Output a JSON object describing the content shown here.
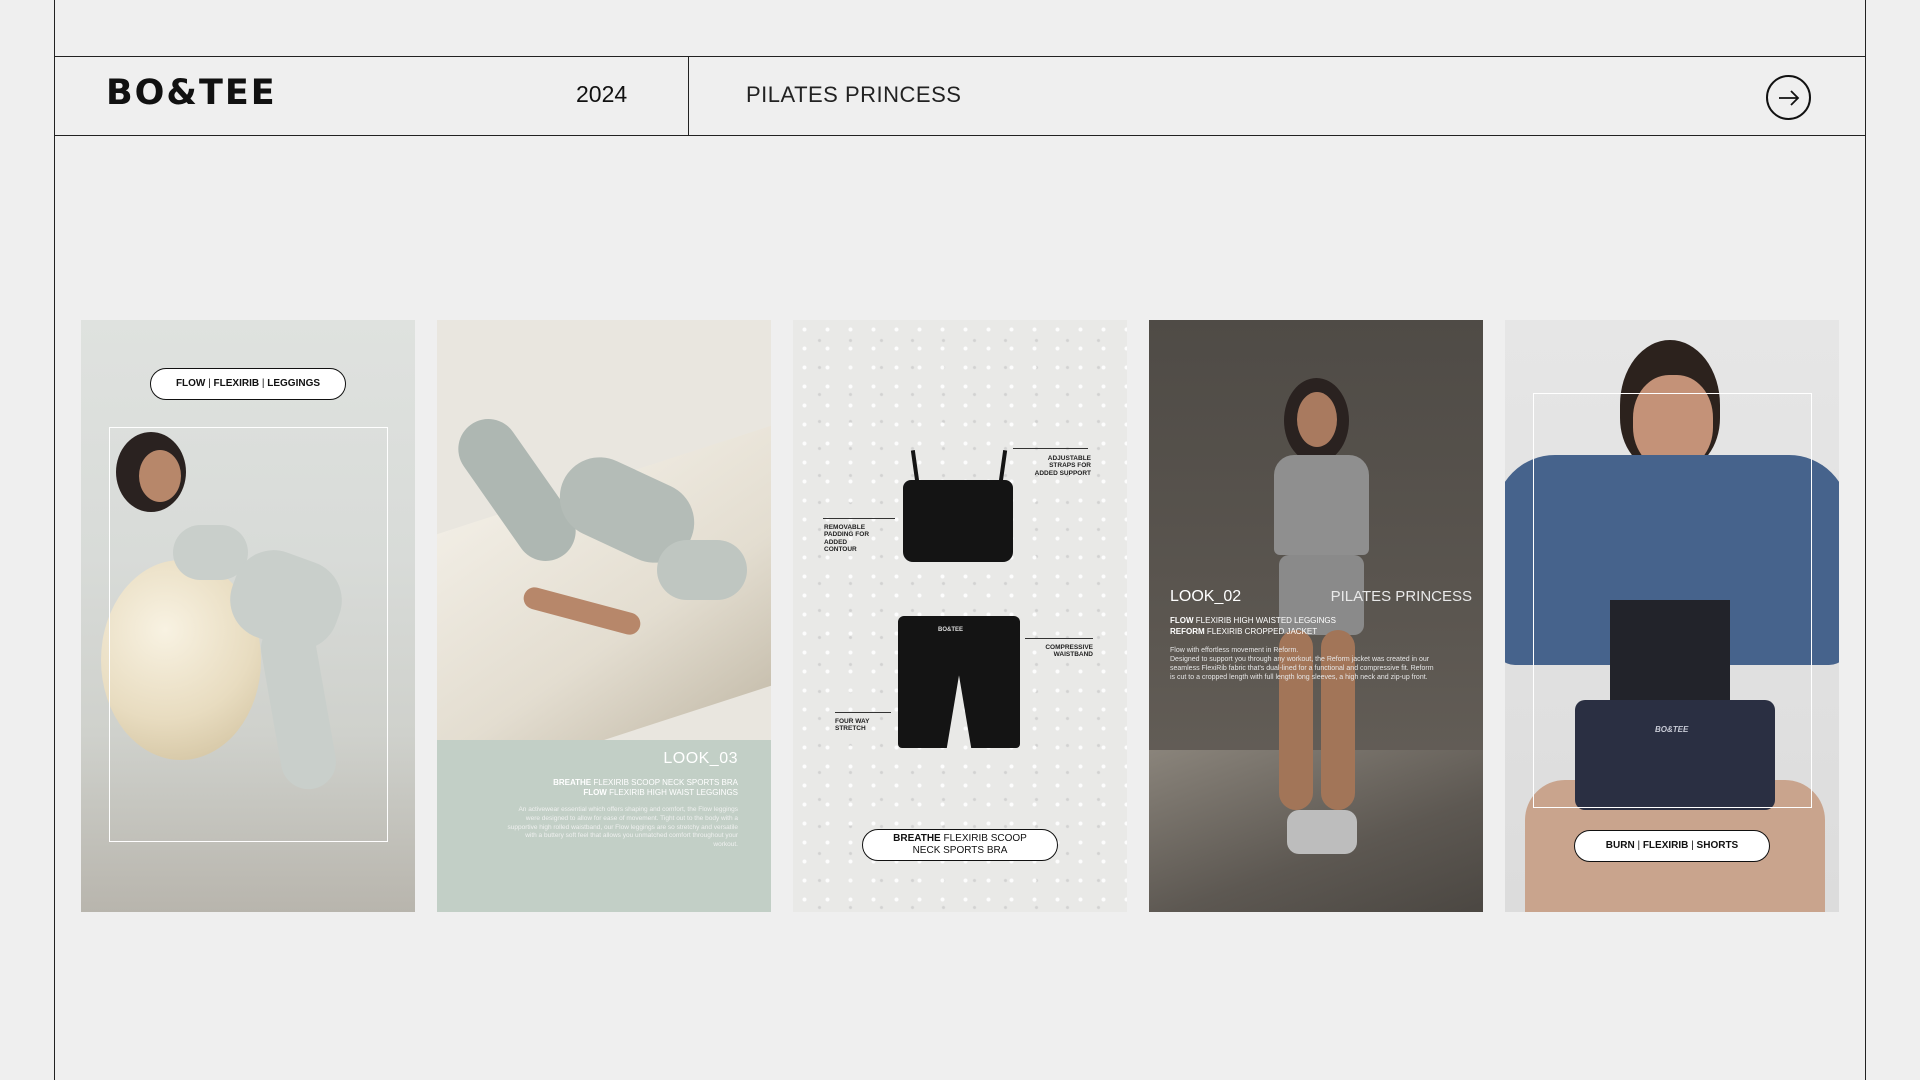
{
  "header": {
    "logo": "BO&TEE",
    "year": "2024",
    "collection_title": "PILATES PRINCESS"
  },
  "icons": {
    "next": "arrow-right-icon"
  },
  "cards": [
    {
      "pill": {
        "bold1": "FLOW",
        "sep1": " | ",
        "bold2": "FLEXIRIB",
        "sep2": " | ",
        "bold3": "LEGGINGS"
      }
    },
    {
      "look_title": "LOOK_03",
      "line1_bold": "BREATHE",
      "line1_rest": " FLEXIRIB SCOOP NECK SPORTS BRA",
      "line2_bold": "FLOW",
      "line2_rest": " FLEXIRIB HIGH WAIST LEGGINGS",
      "body": "An activewear essential which offers shaping and comfort, the Flow leggings were designed to allow for ease of movement. Tight out to the body with a supportive high rolled waistband, our Flow leggings are so stretchy and versatile with a buttery soft feel that allows you unmatched comfort throughout your workout."
    },
    {
      "tag_straps": "ADJUSTABLE STRAPS FOR ADDED SUPPORT",
      "tag_padding": "REMOVABLE PADDING FOR ADDED CONTOUR",
      "tag_waistband": "COMPRESSIVE WAISTBAND",
      "tag_stretch": "FOUR WAY STRETCH",
      "shorts_logo": "BO&TEE",
      "pill_bold": "BREATHE",
      "pill_rest": " FLEXIRIB SCOOP NECK SPORTS BRA"
    },
    {
      "look_title": "LOOK_02",
      "right_title": "PILATES PRINCESS",
      "line1_bold": "FLOW",
      "line1_rest": " FLEXIRIB HIGH WAISTED LEGGINGS",
      "line2_bold": "REFORM",
      "line2_rest": " FLEXIRIB CROPPED JACKET",
      "body_line1": "Flow with effortless movement in Reform.",
      "body_line2": "Designed to support you through any workout, the Reform jacket was created in our seamless FlexiRib fabric that's dual-lined for a functional and compressive fit. Reform is cut to a cropped length with full length long sleeves, a high neck and zip-up front."
    },
    {
      "pill": {
        "bold1": "BURN",
        "sep1": " | ",
        "bold2": "FLEXIRIB",
        "sep2": " | ",
        "bold3": "SHORTS"
      },
      "shorts_logo": "BO&TEE"
    }
  ]
}
